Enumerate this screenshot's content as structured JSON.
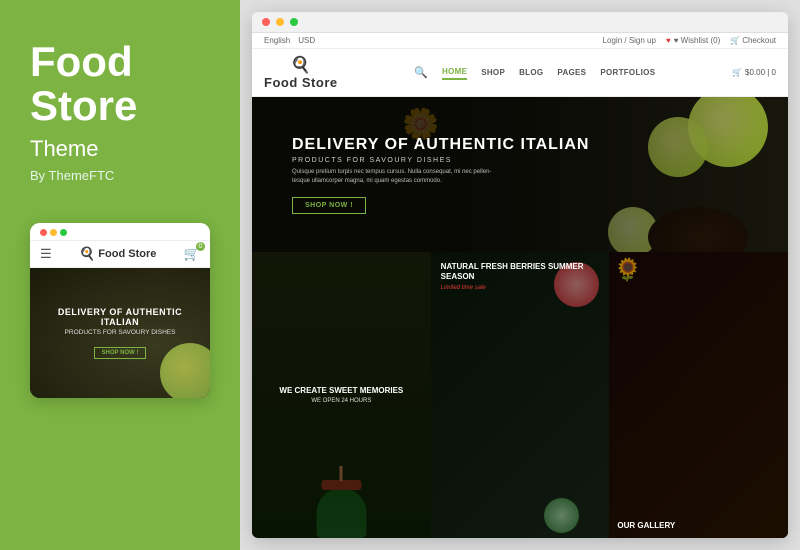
{
  "left": {
    "title_line1": "Food",
    "title_line2": "Store",
    "subtitle": "Theme",
    "by": "By ThemeFTC"
  },
  "mobile": {
    "logo_text": "Food Store",
    "hero_title": "DELIVERY OF AUTHENTIC ITALIAN",
    "hero_sub": "PRODUCTS FOR SAVOURY DISHES",
    "hero_btn": "SHOP NOW !"
  },
  "browser": {
    "topbar": {
      "lang": "English",
      "currency": "USD",
      "login": "Login / Sign up",
      "wishlist": "♥ Wishlist (0)",
      "checkout": "Checkout"
    },
    "logo": "Food Store",
    "nav": {
      "home": "HOME",
      "shop": "SHOP",
      "blog": "BLOG",
      "pages": "PAGES",
      "portfolios": "PORTFOLIOS"
    },
    "cart": "$0.00 | 0",
    "hero": {
      "title": "DELIVERY OF AUTHENTIC ITALIAN",
      "subtitle": "PRODUCTS FOR SAVOURY DISHES",
      "description": "Quisque pretium turpis nec tempus cursus. Nulla consequat, mi nec pellen-tesque ullamcorper magna, mi quam egestas commodo.",
      "button": "SHOP NOW !"
    },
    "cards": [
      {
        "title": "WE CREATE SWEET MEMORIES",
        "subtitle": "WE OPEN 24 HOURS"
      },
      {
        "title": "NATURAL FRESH BERRIES SUMMER SEASON",
        "subtitle": "Limited time sale"
      },
      {
        "title": "OUR GALLERY",
        "subtitle": ""
      },
      {
        "title": "",
        "subtitle": ""
      }
    ]
  },
  "colors": {
    "green": "#7cb342",
    "dark_green": "#5a8a28",
    "red": "#e53935",
    "browser_dot_red": "#ff5f57",
    "browser_dot_yellow": "#ffbd2e",
    "browser_dot_green": "#28ca41",
    "mobile_dot_red": "#ff5f57",
    "mobile_dot_yellow": "#ffbd2e",
    "mobile_dot_green": "#28ca41"
  }
}
